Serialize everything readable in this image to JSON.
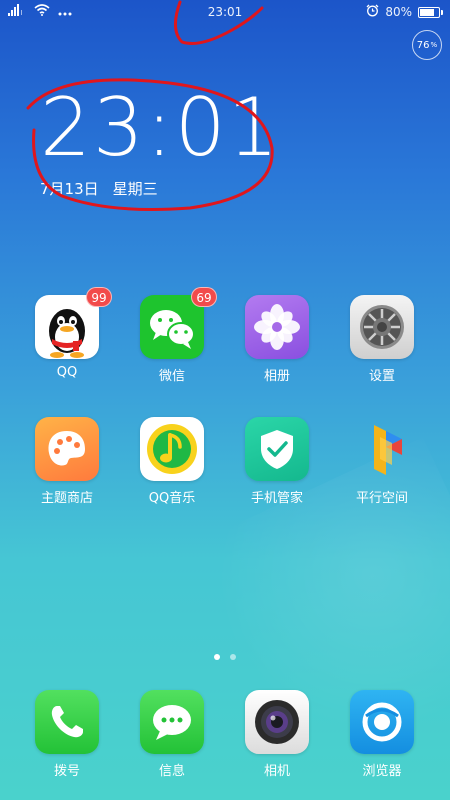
{
  "status_bar": {
    "time": "23:01",
    "battery_percent": "80%",
    "battery_level": 0.8,
    "icons": [
      "signal-icon",
      "wifi-icon",
      "more-dots-icon",
      "alarm-icon",
      "battery-icon"
    ]
  },
  "memory_widget": {
    "value": "76",
    "unit": "%"
  },
  "clock": {
    "time": "23:01",
    "date": "7月13日",
    "weekday": "星期三"
  },
  "apps_row1": [
    {
      "label": "QQ",
      "badge": "99",
      "icon": "qq-penguin-icon"
    },
    {
      "label": "微信",
      "badge": "69",
      "icon": "wechat-icon"
    },
    {
      "label": "相册",
      "badge": "",
      "icon": "gallery-flower-icon"
    },
    {
      "label": "设置",
      "badge": "",
      "icon": "settings-gear-icon"
    }
  ],
  "apps_row2": [
    {
      "label": "主题商店",
      "icon": "theme-palette-icon"
    },
    {
      "label": "QQ音乐",
      "icon": "qq-music-icon"
    },
    {
      "label": "手机管家",
      "icon": "shield-check-icon"
    },
    {
      "label": "平行空间",
      "icon": "parallel-space-icon"
    }
  ],
  "page_indicator": {
    "pages": 2,
    "current": 1
  },
  "dock": [
    {
      "label": "拨号",
      "icon": "phone-icon"
    },
    {
      "label": "信息",
      "icon": "message-icon"
    },
    {
      "label": "相机",
      "icon": "camera-icon"
    },
    {
      "label": "浏览器",
      "icon": "browser-icon"
    }
  ],
  "colors": {
    "badge": "#f24b4b",
    "annotation": "#e0161c"
  }
}
